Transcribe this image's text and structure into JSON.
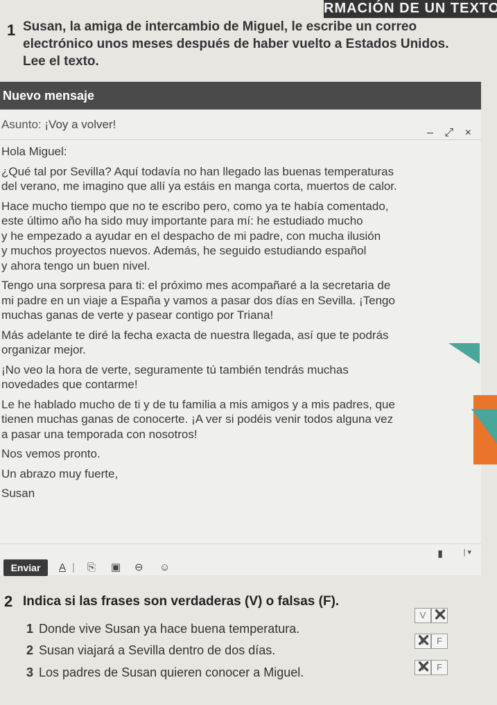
{
  "banner": "RMACIÓN DE UN TEXTO",
  "exercise1": {
    "number": "1",
    "intro_line1": "Susan, la amiga de intercambio de Miguel, le escribe un correo",
    "intro_line2": "electrónico unos meses después de haber vuelto a Estados Unidos.",
    "intro_line3": "Lee el texto."
  },
  "email": {
    "header_title": "Nuevo mensaje",
    "subject_label": "Asunto:",
    "subject_value": "¡Voy a volver!",
    "window_controls": "– ⤢ ×",
    "body": [
      "Hola Miguel:",
      "¿Qué tal por Sevilla? Aquí todavía no han llegado las buenas temperaturas",
      "del verano, me imagino que allí ya estáis en manga corta, muertos de calor.",
      "Hace mucho tiempo que no te escribo pero, como ya te había comentado,",
      "este último año ha sido muy importante para mí: he estudiado mucho",
      "y he empezado a ayudar en el despacho de mi padre, con mucha ilusión",
      "y muchos proyectos nuevos. Además, he seguido estudiando español",
      "y ahora tengo un buen nivel.",
      "Tengo una sorpresa para ti: el próximo mes acompañaré a la secretaria de",
      "mi padre en un viaje a España y vamos a pasar dos días en Sevilla. ¡Tengo",
      "muchas ganas de verte y pasear contigo por Triana!",
      "Más adelante te diré la fecha exacta de nuestra llegada, así que te podrás",
      "organizar mejor.",
      "¡No veo la hora de verte, seguramente tú también tendrás muchas",
      "novedades que contarme!",
      "Le he hablado mucho de ti y de tu familia a mis amigos y a mis padres, que",
      "tienen muchas ganas de conocerte. ¡A ver si podéis venir todos alguna vez",
      "a pasar una temporada con nosotros!",
      "Nos vemos pronto.",
      "Un abrazo muy fuerte,",
      "Susan"
    ],
    "send_label": "Enviar",
    "tool_format": "A",
    "tool_attach": "⎘",
    "tool_image": "▣",
    "tool_link": "⊖",
    "tool_emoji": "☺",
    "tool_trash": "▮",
    "tool_more": "| ▾"
  },
  "exercise2": {
    "number": "2",
    "title": "Indica si las frases son verdaderas (V) o falsas (F).",
    "items": [
      {
        "n": "1",
        "text": "Donde vive Susan ya hace buena temperatura.",
        "v": "V",
        "f": "F",
        "marked": "F"
      },
      {
        "n": "2",
        "text": "Susan viajará a Sevilla dentro de dos días.",
        "v": "V",
        "f": "F",
        "marked": "V"
      },
      {
        "n": "3",
        "text": "Los padres de Susan quieren conocer a Miguel.",
        "v": "V",
        "f": "F",
        "marked": "V"
      }
    ]
  },
  "colors": {
    "teal": "#4aa59b",
    "orange": "#e9742a",
    "header": "#4a4a4a"
  }
}
